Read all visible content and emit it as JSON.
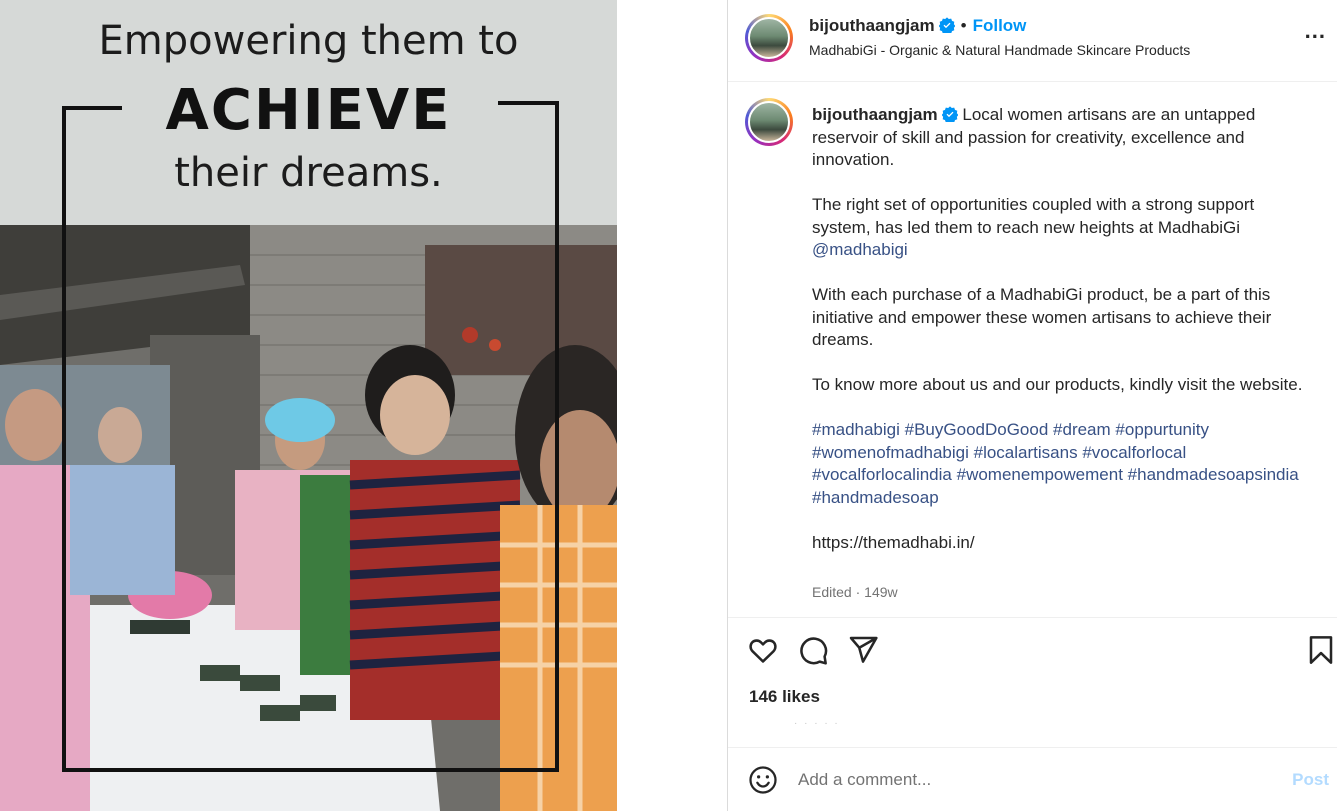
{
  "image": {
    "line1": "Empowering them to",
    "line2": "ACHIEVE",
    "line3": "their dreams."
  },
  "header": {
    "username": "bijouthaangjam",
    "verified_icon": "verified-badge-icon",
    "separator": "•",
    "follow_label": "Follow",
    "subtitle": "MadhabiGi - Organic & Natural Handmade Skincare Products",
    "more_label": "..."
  },
  "caption": {
    "username": "bijouthaangjam",
    "p1": "Local women artisans are an untapped reservoir of skill and passion for creativity, excellence and innovation.",
    "p2_text": "The right set of opportunities coupled with a strong support system, has led them to reach new heights at MadhabiGi",
    "p2_mention": "@madhabigi",
    "p3": "With each purchase of a MadhabiGi product, be a part of this initiative and empower these women artisans to achieve their dreams.",
    "p4": "To know more about us and our products, kindly visit the website.",
    "hashtags": [
      "#madhabigi",
      "#BuyGoodDoGood",
      "#dream",
      "#oppurtunity",
      "#womenofmadhabigi",
      "#localartisans",
      "#vocalforlocal",
      "#vocalforlocalindia",
      "#womenempowement",
      "#handmadesoapsindia",
      "#handmadesoap"
    ],
    "url": "https://themadhabi.in/",
    "edited": "Edited",
    "meta_sep": "·",
    "age": "149w"
  },
  "actions": {
    "like_icon": "heart-icon",
    "comment_icon": "comment-icon",
    "share_icon": "send-icon",
    "save_icon": "bookmark-icon",
    "likes": "146 likes"
  },
  "comment": {
    "emoji_icon": "smiley-icon",
    "placeholder": "Add a comment...",
    "post_label": "Post"
  },
  "colors": {
    "follow": "#0095f6",
    "link": "#385185",
    "post_disabled": "#b3dbff",
    "muted": "#737373"
  }
}
